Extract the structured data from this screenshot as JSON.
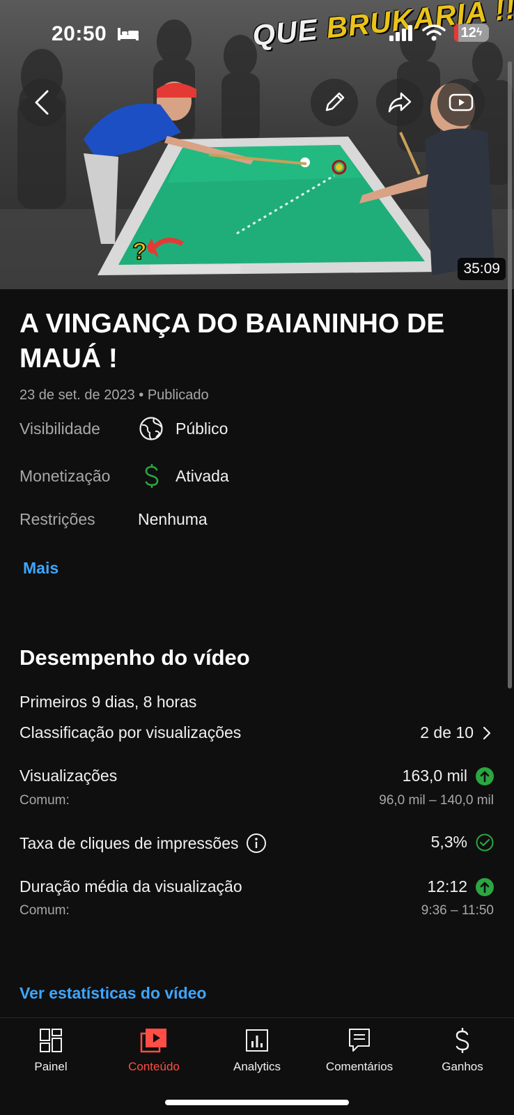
{
  "status_bar": {
    "time": "20:50",
    "battery": "12"
  },
  "thumbnail": {
    "headline_word1": "QUE",
    "headline_word2": "BRUKARIA !!",
    "duration": "35:09"
  },
  "video": {
    "title": "A VINGANÇA DO BAIANINHO DE MAUÁ !",
    "date": "23 de set. de 2023",
    "status": "Publicado",
    "visibility_label": "Visibilidade",
    "visibility_value": "Público",
    "monetization_label": "Monetização",
    "monetization_value": "Ativada",
    "restrictions_label": "Restrições",
    "restrictions_value": "Nenhuma",
    "more_link": "Mais"
  },
  "performance": {
    "title": "Desempenho do vídeo",
    "period": "Primeiros 9 dias, 8 horas",
    "ranking_label": "Classificação por visualizações",
    "ranking_value": "2 de 10",
    "views_label": "Visualizações",
    "views_value": "163,0 mil",
    "views_common_label": "Comum:",
    "views_common_range": "96,0 mil – 140,0 mil",
    "ctr_label": "Taxa de cliques de impressões",
    "ctr_value": "5,3%",
    "avd_label": "Duração média da visualização",
    "avd_value": "12:12",
    "avd_common_label": "Comum:",
    "avd_common_range": "9:36 – 11:50",
    "stats_link": "Ver estatísticas do vídeo"
  },
  "nav": {
    "items": [
      {
        "label": "Painel",
        "icon": "dashboard-icon"
      },
      {
        "label": "Conteúdo",
        "icon": "content-icon",
        "active": true
      },
      {
        "label": "Analytics",
        "icon": "analytics-icon"
      },
      {
        "label": "Comentários",
        "icon": "comments-icon"
      },
      {
        "label": "Ganhos",
        "icon": "earnings-icon"
      }
    ]
  },
  "colors": {
    "accent_red": "#ff4e45",
    "link_blue": "#3ea6ff",
    "positive_green": "#2ba640",
    "table_green": "#1fae7a"
  }
}
